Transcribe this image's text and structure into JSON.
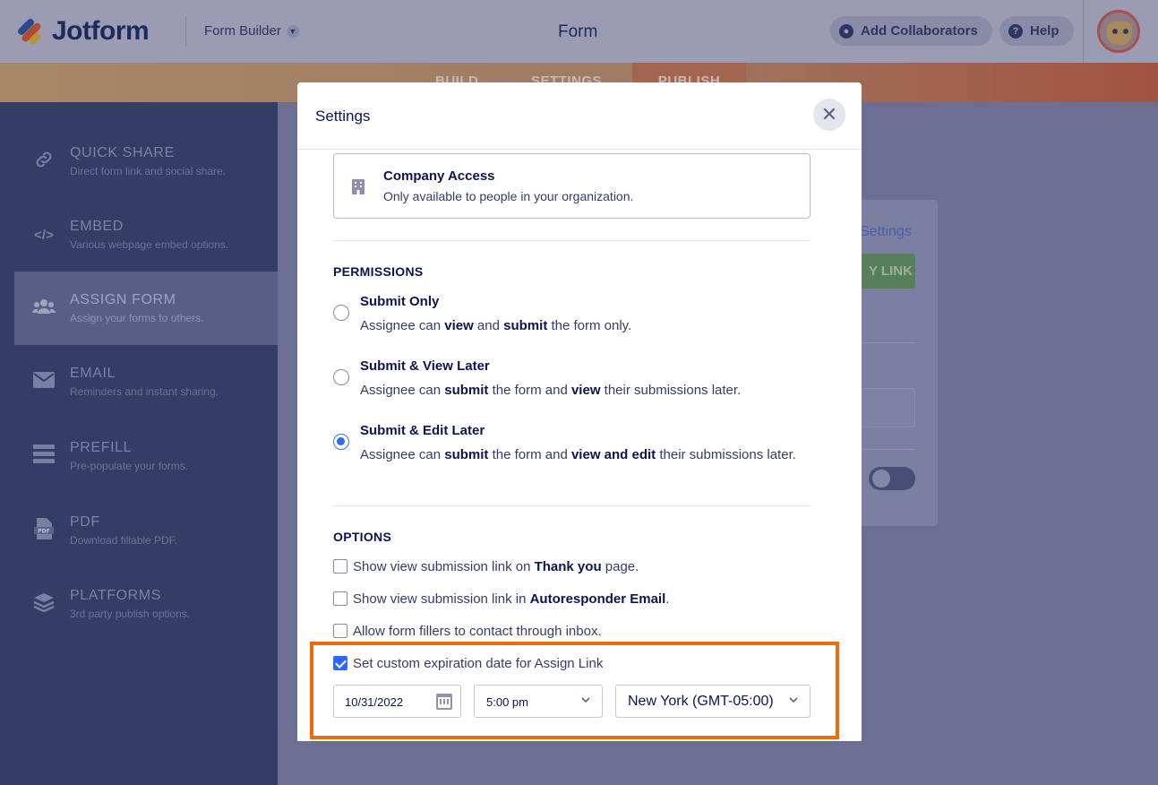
{
  "header": {
    "logo_text": "Jotform",
    "builder_label": "Form Builder",
    "form_title": "Form",
    "add_collaborators": "Add Collaborators",
    "help": "Help"
  },
  "tabs": {
    "build": "BUILD",
    "settings": "SETTINGS",
    "publish": "PUBLISH"
  },
  "sidebar": {
    "items": [
      {
        "title": "QUICK SHARE",
        "desc": "Direct form link and social share.",
        "icon": "link-icon"
      },
      {
        "title": "EMBED",
        "desc": "Various webpage embed options.",
        "icon": "code-icon"
      },
      {
        "title": "ASSIGN FORM",
        "desc": "Assign your forms to others.",
        "icon": "users-icon"
      },
      {
        "title": "EMAIL",
        "desc": "Reminders and instant sharing.",
        "icon": "envelope-icon"
      },
      {
        "title": "PREFILL",
        "desc": "Pre-populate your forms.",
        "icon": "prefill-icon"
      },
      {
        "title": "PDF",
        "desc": "Download fillable PDF.",
        "icon": "pdf-icon"
      },
      {
        "title": "PLATFORMS",
        "desc": "3rd party publish options.",
        "icon": "layers-icon"
      }
    ]
  },
  "background": {
    "settings_link": "Settings",
    "button_label": "Y LINK"
  },
  "modal": {
    "title": "Settings",
    "access": {
      "title": "Company Access",
      "desc": "Only available to people in your organization."
    },
    "permissions_label": "PERMISSIONS",
    "options_label": "OPTIONS",
    "custom_expiration_label": "Set custom expiration date for Assign Link",
    "date_value": "10/31/2022",
    "time_value": "5:00 pm",
    "timezone_value": "New York (GMT-05:00)"
  },
  "colors": {
    "accent": "#2e69ff",
    "highlight": "#f26a0e"
  }
}
